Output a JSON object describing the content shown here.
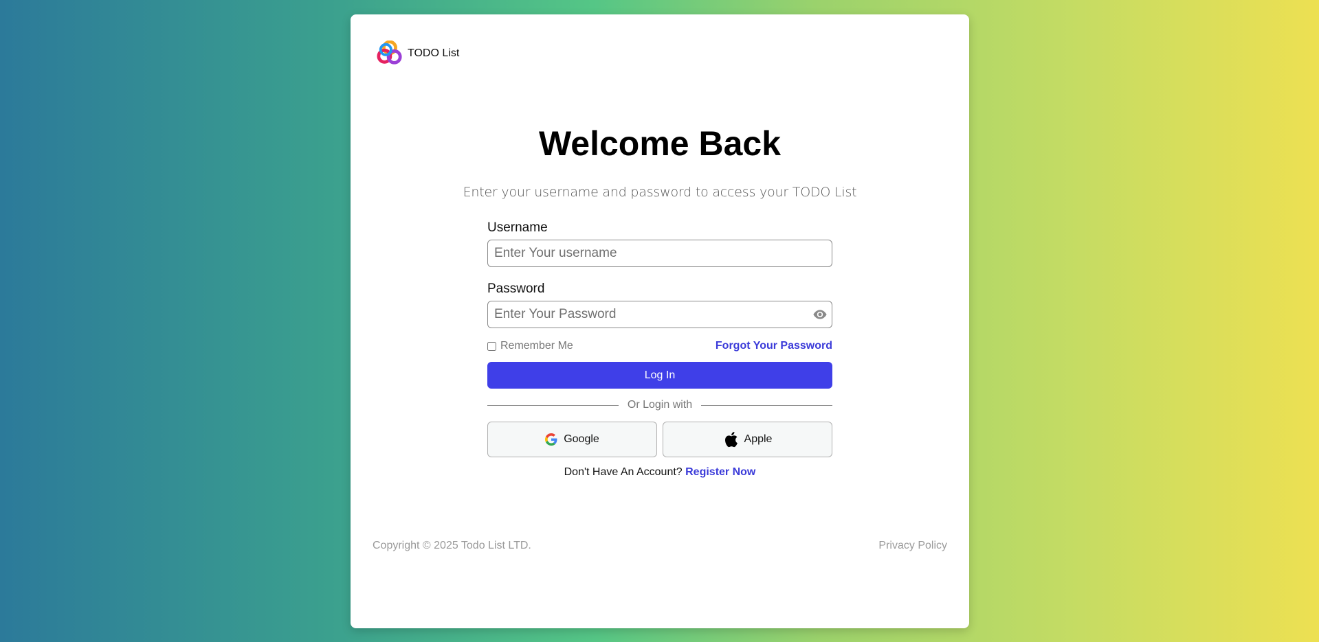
{
  "brand": {
    "name": "TODO List",
    "logo_icon": "colorful-pinwheel-icon"
  },
  "header": {
    "title": "Welcome Back",
    "subtitle": "Enter your username and password to access your TODO List"
  },
  "form": {
    "username": {
      "label": "Username",
      "placeholder": "Enter Your username",
      "value": ""
    },
    "password": {
      "label": "Password",
      "placeholder": "Enter Your Password",
      "value": "",
      "toggle_icon": "eye-icon"
    },
    "remember_me": {
      "label": "Remember Me",
      "checked": false
    },
    "forgot_password_label": "Forgot Your Password",
    "login_button_label": "Log In",
    "divider_text": "Or Login with"
  },
  "social": {
    "google_label": "Google",
    "apple_label": "Apple"
  },
  "register": {
    "prompt": "Don't Have An Account?",
    "link_label": "Register Now"
  },
  "footer": {
    "copyright": "Copyright © 2025 Todo List LTD.",
    "privacy_label": "Privacy Policy"
  },
  "colors": {
    "primary": "#3f3fe8",
    "link": "#3b3bd9",
    "gradient_start": "#2c7a9a",
    "gradient_mid": "#55c686",
    "gradient_end": "#ede052"
  }
}
